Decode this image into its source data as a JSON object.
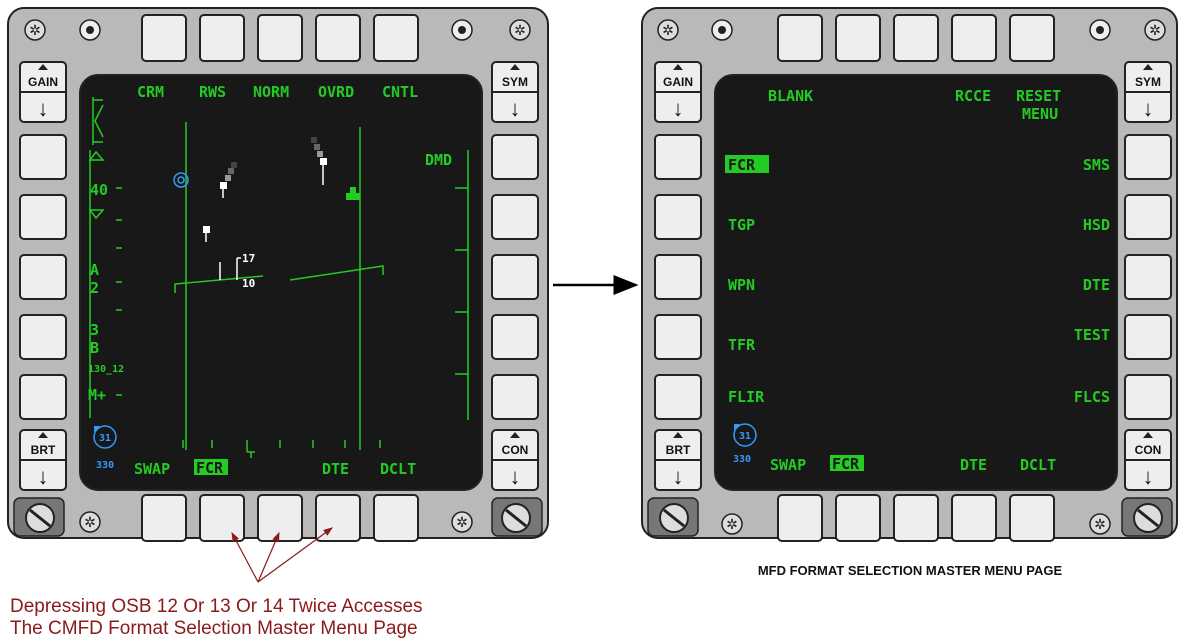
{
  "left_mfd": {
    "top_row": [
      "CRM",
      "RWS",
      "NORM",
      "OVRD",
      "CNTL"
    ],
    "left_col": [
      "40",
      "A",
      "2",
      "3",
      "B",
      "130_12",
      "M+"
    ],
    "right_col": [
      "DMD"
    ],
    "bottom_row": [
      "SWAP",
      "FCR",
      "DTE",
      "DCLT"
    ],
    "bug_top": "31",
    "bug_bottom": "330",
    "radar_labels": [
      "17",
      "10"
    ]
  },
  "right_mfd": {
    "top_left": "BLANK",
    "top_right_a": "RCCE",
    "top_right_b": "RESET",
    "top_right_c": "MENU",
    "left_col": [
      "FCR",
      "TGP",
      "WPN",
      "TFR",
      "FLIR"
    ],
    "right_col": [
      "SMS",
      "HSD",
      "DTE",
      "TEST",
      "FLCS"
    ],
    "bottom_row": [
      "SWAP",
      "FCR",
      "DTE",
      "DCLT"
    ],
    "bug_top": "31",
    "bug_bottom": "330"
  },
  "rocker_labels": {
    "gain": "GAIN",
    "sym": "SYM",
    "brt": "BRT",
    "con": "CON"
  },
  "caption_left_line1": "Depressing OSB 12 Or 13  Or 14 Twice  Accesses",
  "caption_left_line2": "The CMFD Format Selection Master Menu Page",
  "caption_right": "MFD  FORMAT SELECTION  MASTER MENU PAGE",
  "colors": {
    "green": "#22cc22",
    "screen": "#181818",
    "bezel": "#b9b9b9",
    "caption": "#8b1a1a",
    "blue": "#3399ff"
  }
}
